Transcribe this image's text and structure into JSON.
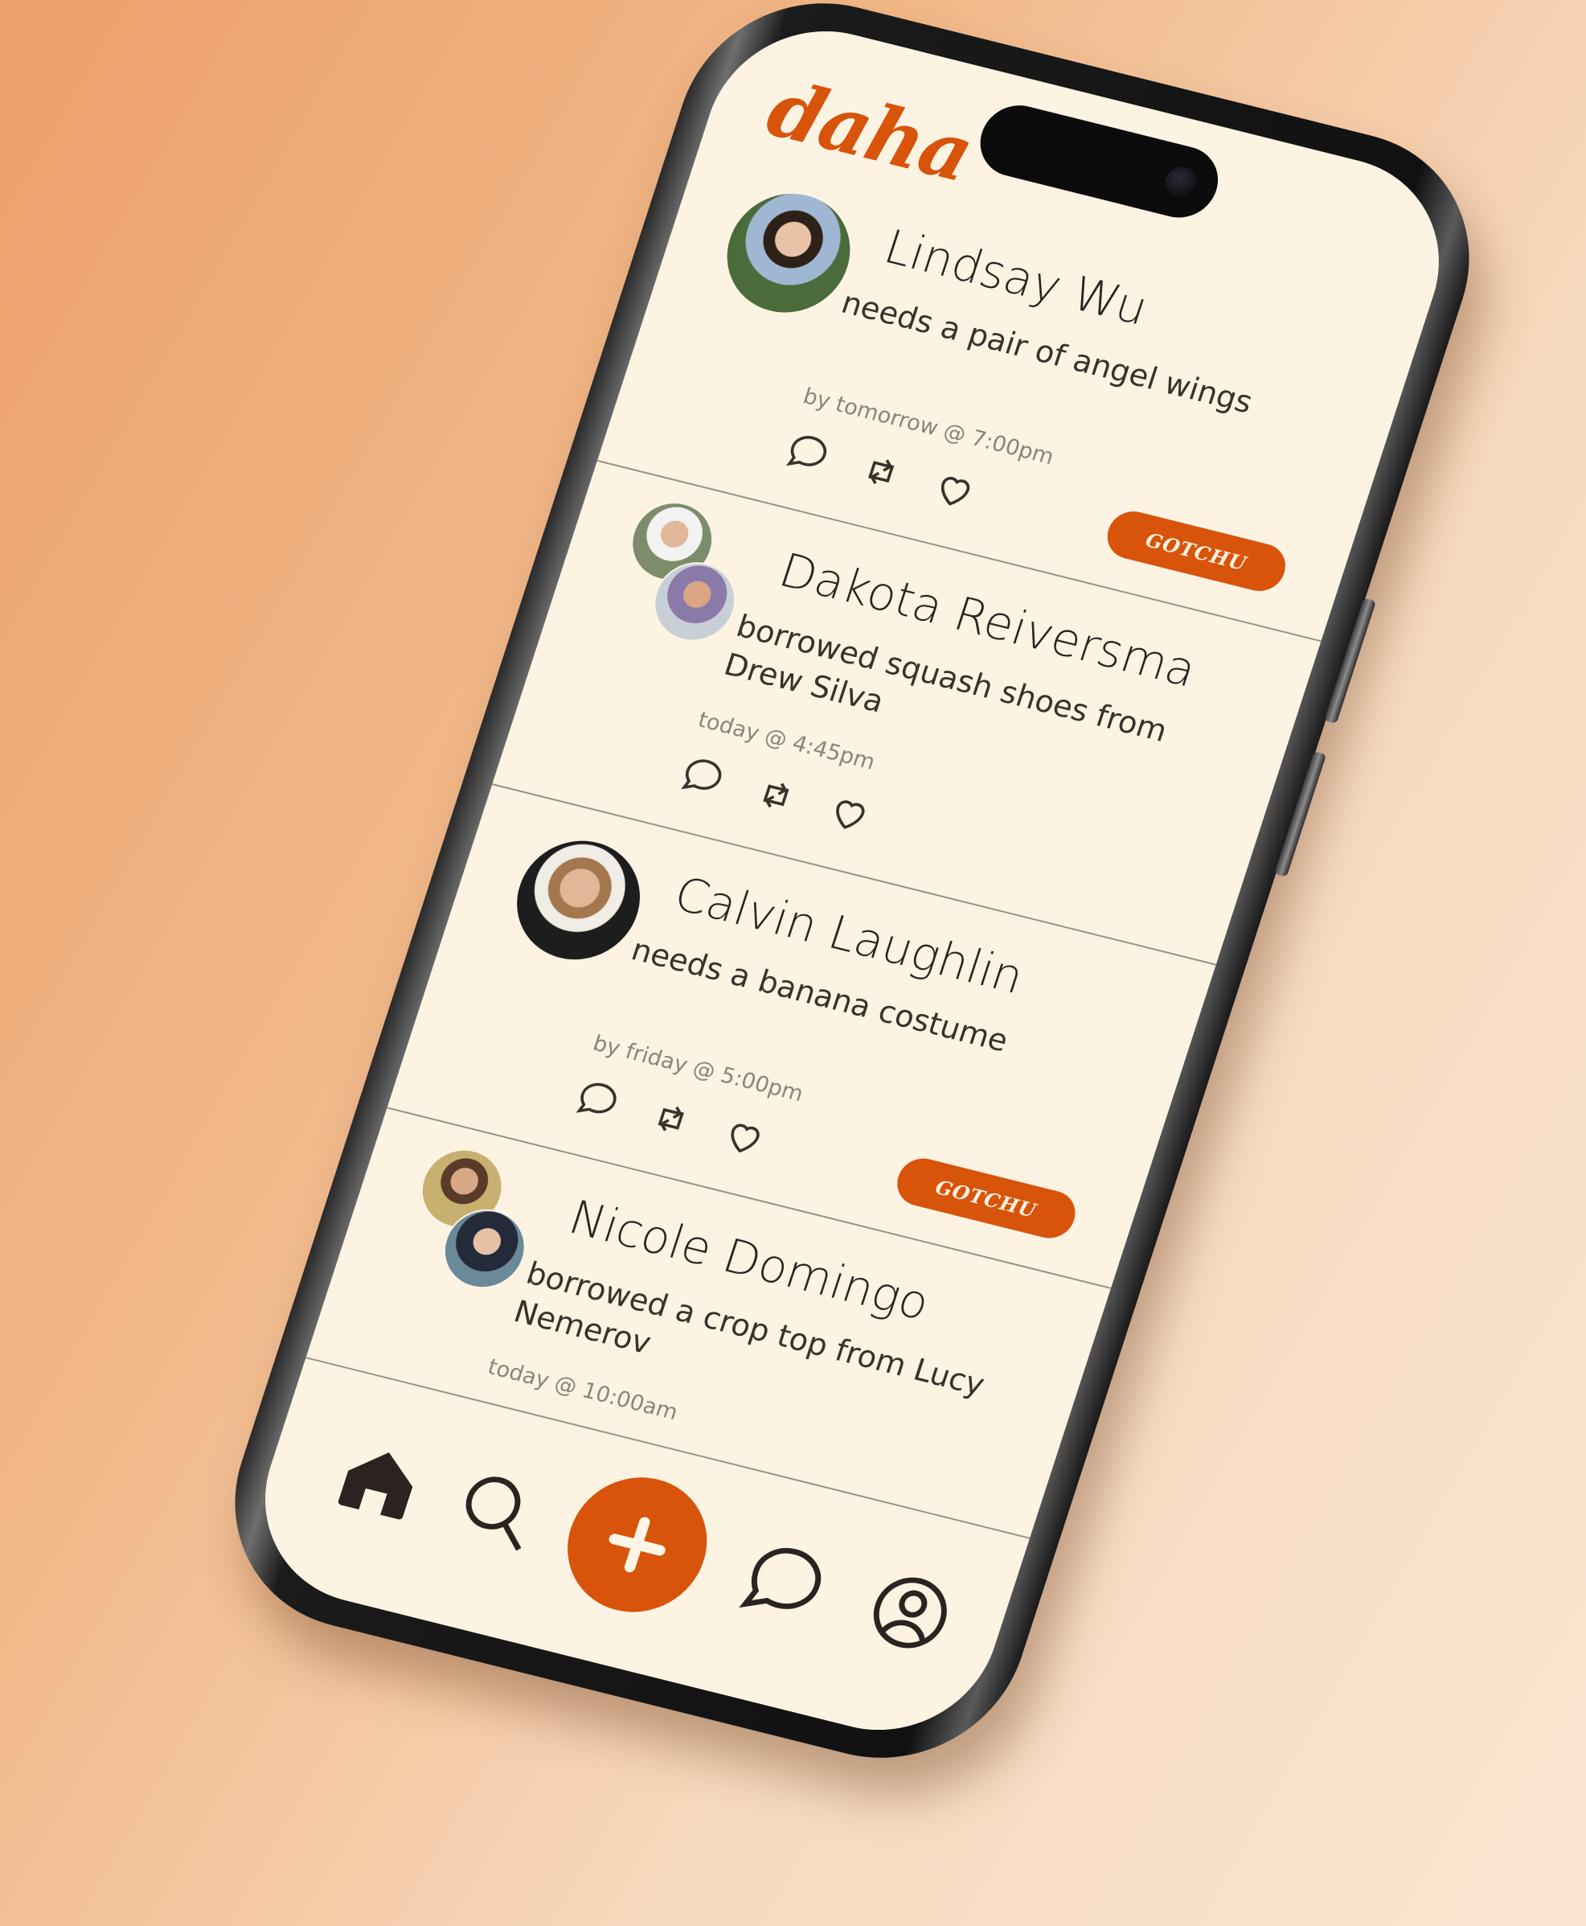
{
  "app": {
    "logo": "daha"
  },
  "feed": {
    "posts": [
      {
        "name": "Lindsay Wu",
        "description": "needs a pair of angel wings",
        "time": "by tomorrow @ 7:00pm",
        "avatar_count": 1,
        "button": "GOTCHU"
      },
      {
        "name": "Dakota Reiversma",
        "description": "borrowed squash shoes from Drew Silva",
        "time": "today @ 4:45pm",
        "avatar_count": 2,
        "button": ""
      },
      {
        "name": "Calvin Laughlin",
        "description": "needs a banana costume",
        "time": "by friday @ 5:00pm",
        "avatar_count": 1,
        "button": "GOTCHU"
      },
      {
        "name": "Nicole Domingo",
        "description": "borrowed a crop top from Lucy Nemerov",
        "time": "today @ 10:00am",
        "avatar_count": 2,
        "button": ""
      }
    ]
  },
  "post_actions": [
    "comment-icon",
    "repost-icon",
    "heart-icon"
  ],
  "nav": {
    "items": [
      "home-icon",
      "search-icon",
      "plus-icon",
      "chat-icon",
      "profile-icon"
    ]
  },
  "colors": {
    "accent": "#d8540a",
    "screen_bg": "#fdf3e3",
    "text": "#2a2320",
    "muted": "#8e837b"
  }
}
